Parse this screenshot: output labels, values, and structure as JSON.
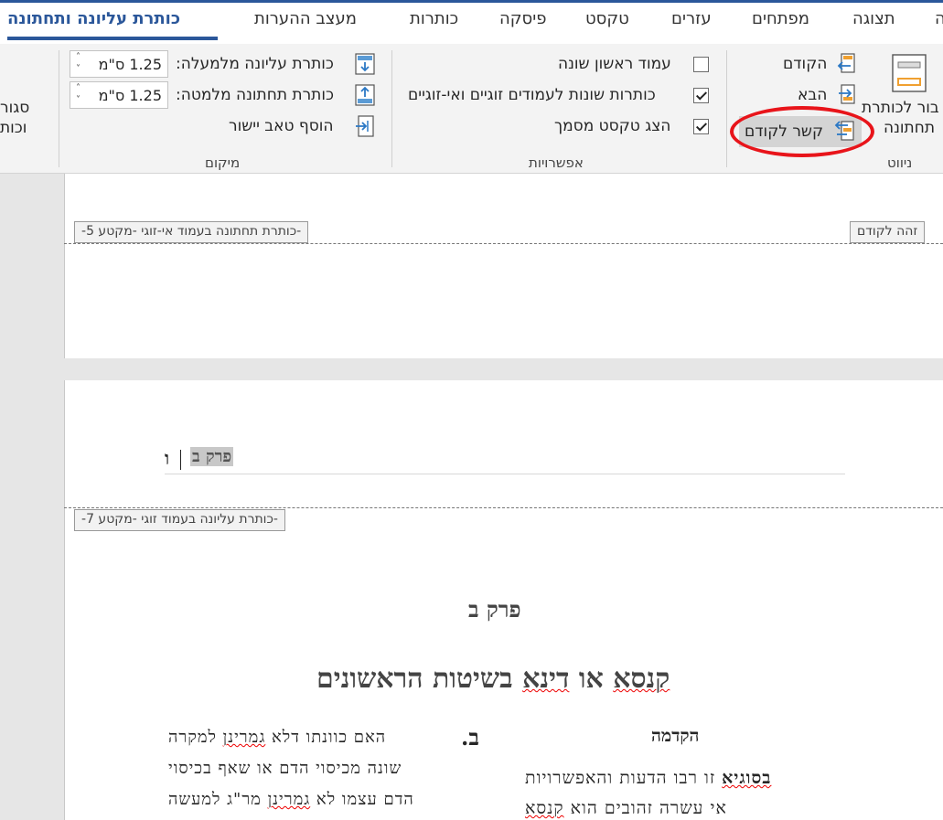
{
  "tabs": [
    {
      "label": "כותרת עליונה ותחתונה",
      "active": true
    },
    {
      "label": "מעצב ההערות"
    },
    {
      "label": "כותרות"
    },
    {
      "label": "פיסקה"
    },
    {
      "label": "טקסט"
    },
    {
      "label": "עזרים"
    },
    {
      "label": "מפתחים"
    },
    {
      "label": "תצוגה"
    },
    {
      "label": "ה"
    }
  ],
  "ribbon": {
    "close": {
      "line1": "סגור",
      "line2": "וכות"
    },
    "position": {
      "header_from_top_label": "כותרת עליונה מלמעלה:",
      "header_from_top_value": "1.25 ס\"מ",
      "footer_from_bottom_label": "כותרת תחתונה מלמטה:",
      "footer_from_bottom_value": "1.25 ס\"מ",
      "insert_tab_label": "הוסף טאב יישור",
      "group_label": "מיקום"
    },
    "options": {
      "different_first_page": "עמוד ראשון שונה",
      "different_odd_even": "כותרות שונות לעמודים זוגיים ואי-זוגיים",
      "show_document_text": "הצג טקסט מסמך",
      "checked": [
        false,
        true,
        true
      ],
      "group_label": "אפשרויות"
    },
    "navigation": {
      "previous": "הקודם",
      "next": "הבא",
      "link_to_previous": "קשר לקודם",
      "goto_line1": "בור לכותרת",
      "goto_line2": "תחתונה",
      "group_label": "ניווט"
    }
  },
  "document": {
    "footer_tag": "-כותרת תחתונה בעמוד אי-זוגי -מקטע 5-",
    "same_as_previous": "זהה לקודם",
    "header_text": "פרק ב",
    "header_char": "ו",
    "header_tag": "-כותרת עליונה בעמוד זוגי -מקטע 7-",
    "chapter": "פרק ב",
    "title_a": "קנסא",
    "title_b": " או ",
    "title_c": "דינא",
    "title_d": " בשיטות הראשונים",
    "intro_heading": "הקדמה",
    "col_right": {
      "line1_a": "בסוגיא",
      "line1_b": " זו רבו הדעות והאפשרויות",
      "line2_a": "אי עשרה זהובים הוא ",
      "line2_b": "קנסא"
    },
    "col_left": {
      "letter": "ב.",
      "line1_a": "האם כוונתו דלא ",
      "line1_b": "גמרינן",
      "line1_c": " למקרה",
      "line2": "שונה מכיסוי הדם או שאף בכיסוי",
      "line3_a": "הדם עצמו לא ",
      "line3_b": "גמרינן",
      "line3_c": " מר\"ג למעשה"
    }
  },
  "colors": {
    "accent": "#2b579a",
    "annotation": "#e8141a"
  }
}
